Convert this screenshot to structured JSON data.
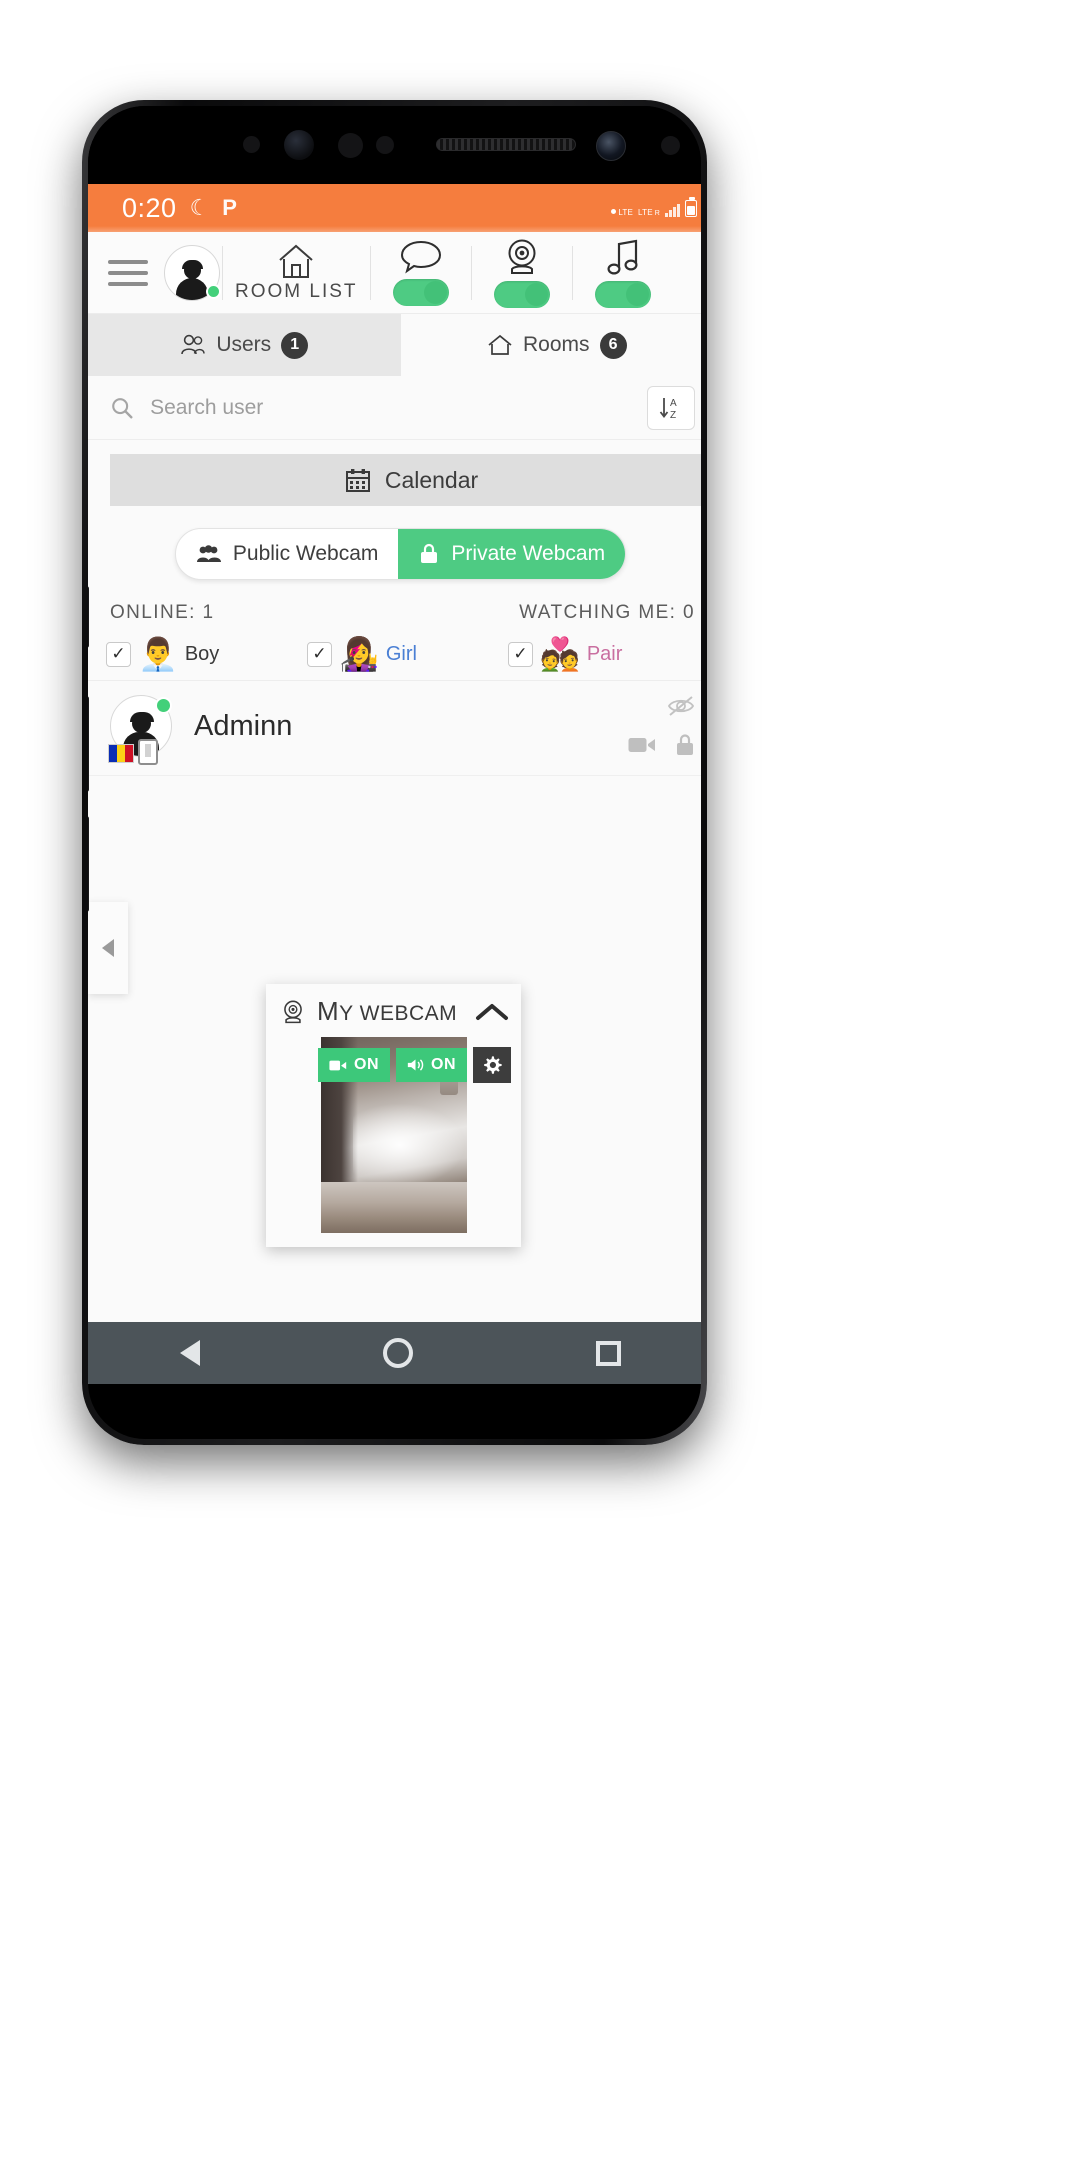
{
  "status_bar": {
    "clock": "0:20",
    "icons": [
      "moon-icon",
      "p-icon"
    ],
    "network_label_1": "LTE",
    "network_label_2": "LTE",
    "network_sub": "R"
  },
  "toolbar": {
    "menu_icon": "hamburger-menu-icon",
    "avatar_icon": "user-avatar-icon",
    "room_list_label": "ROOM LIST",
    "items": [
      {
        "icon": "home-icon",
        "label": "ROOM LIST",
        "toggle": "on"
      },
      {
        "icon": "chat-bubble-icon",
        "label": "",
        "toggle": "on"
      },
      {
        "icon": "webcam-icon",
        "label": "",
        "toggle": "on"
      },
      {
        "icon": "music-note-icon",
        "label": "",
        "toggle": "on"
      }
    ]
  },
  "tabs": [
    {
      "icon": "users-icon",
      "label": "Users",
      "badge": "1",
      "active": true
    },
    {
      "icon": "home-rooms-icon",
      "label": "Rooms",
      "badge": "6",
      "active": false
    }
  ],
  "search": {
    "placeholder": "Search user",
    "value": "",
    "icon": "search-icon",
    "sort_icon": "sort-alpha-icon"
  },
  "calendar": {
    "label": "Calendar",
    "icon": "calendar-icon"
  },
  "webcam_switch": {
    "public_label": "Public Webcam",
    "public_icon": "group-people-icon",
    "private_label": "Private Webcam",
    "private_icon": "lock-cam-icon",
    "selected": "Private Webcam",
    "selected_color": "#4ecb83"
  },
  "counts": {
    "online_label": "ONLINE: 1",
    "watching_label": "WATCHING ME: 0"
  },
  "gender_filters": [
    {
      "label": "Boy",
      "emoji": "👨‍💼",
      "checked": true
    },
    {
      "label": "Girl",
      "emoji": "👩‍🎤",
      "checked": true
    },
    {
      "label": "Pair",
      "emoji": "💑",
      "checked": true
    }
  ],
  "user_row": {
    "name": "Adminn",
    "online": true,
    "status_color": "#43d07a",
    "flag": "romania-flag-icon",
    "device_icon": "mobile-device-icon",
    "hidden_eye_icon": "eye-slash-icon",
    "camera_icon": "video-camera-icon",
    "lock_icon": "lock-icon"
  },
  "drawer_handle": {
    "icon": "chevron-left-icon"
  },
  "my_webcam": {
    "title_cap": "M",
    "title_rest": "Y WEBCAM",
    "panel_icon": "webcam-icon",
    "collapse_icon": "chevron-up-icon",
    "controls": [
      {
        "icon": "video-camera-icon",
        "label": "ON",
        "color": "#3dc87a"
      },
      {
        "icon": "speaker-icon",
        "label": "ON",
        "color": "#3dc87a"
      },
      {
        "icon": "gear-icon",
        "label": "",
        "color": "#3d3d3d"
      }
    ]
  },
  "navbar": {
    "back": "back-triangle-icon",
    "home": "home-circle-icon",
    "recents": "recents-square-icon"
  },
  "theme": {
    "accent_orange": "#F57D3E",
    "accent_green": "#4ecb83",
    "dark": "#3a3a3a"
  }
}
